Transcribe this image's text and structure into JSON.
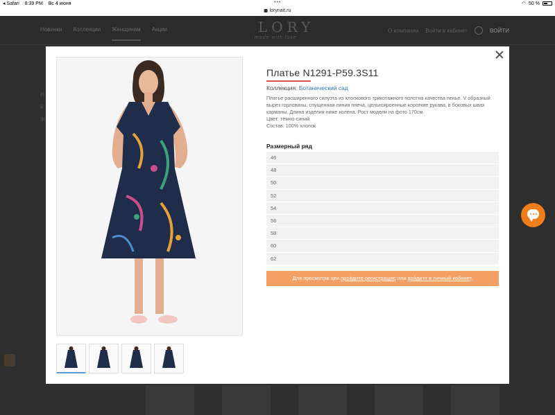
{
  "status_bar": {
    "carrier": "◂ Safari",
    "time": "8:39 PM",
    "date": "Вс 4 июня",
    "battery": "50 %"
  },
  "browser": {
    "url": "lorynait.ru"
  },
  "site": {
    "nav": [
      "Новинки",
      "Коллекции",
      "Женщинам",
      "Акции"
    ],
    "logo": "LORY",
    "logo_sub": "made with love",
    "header_right": [
      "О компании",
      "Войти в кабинет"
    ],
    "login": "ВОЙТИ",
    "side_links": [
      "Н",
      "К",
      "Ж"
    ]
  },
  "product": {
    "title": "Платье N1291-P59.3S11",
    "collection_label": "Коллекция:",
    "collection_name": "Ботанический сад",
    "description": "Платье расширенного силуэта из хлопкового трикотажного полотна качества пенье. V образный вырез горловины, спущенная линия плеча, цельнокроенные короткие рукава, в боковых швах карманы. Длина изделия ниже колена. Рост модели на фото 170см.",
    "color": "Цвет: тёмно-синий",
    "composition": "Состав: 100% хлопок",
    "sizes_heading": "Размерный ряд",
    "sizes": [
      "46",
      "48",
      "50",
      "52",
      "54",
      "56",
      "58",
      "60",
      "62"
    ],
    "price_notice": {
      "prefix": "Для просмотра цен ",
      "link1": "пройдите регистрацию",
      "middle": " или ",
      "link2": "войдите в личный кабинет",
      "suffix": "."
    }
  },
  "colors": {
    "accent_orange": "#f4a064",
    "chat_orange": "#ef7d1a",
    "link_blue": "#2a73b8",
    "title_underline": "#d9534f",
    "dress_navy": "#1f2d4a"
  }
}
